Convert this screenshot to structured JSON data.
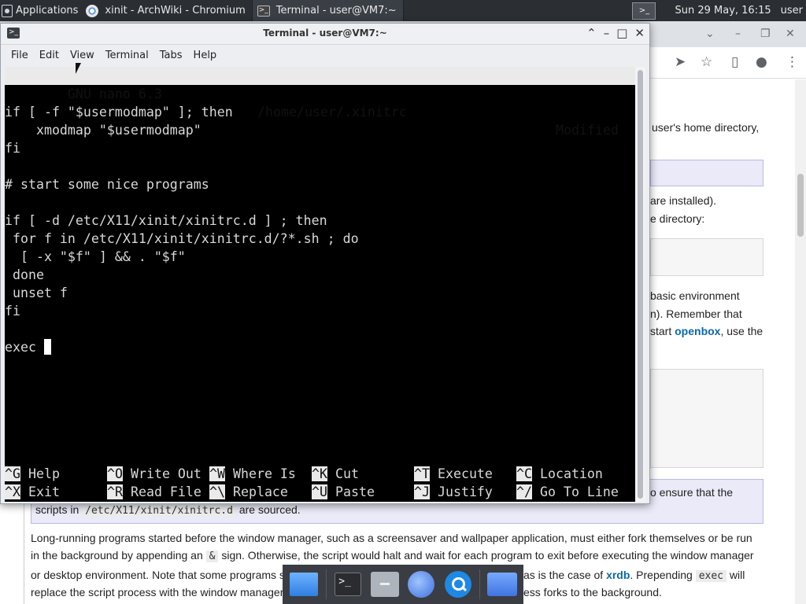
{
  "panel": {
    "applications": "Applications",
    "tasks": [
      {
        "label": "xinit - ArchWiki - Chromium",
        "icon": "chromium-icon"
      },
      {
        "label": "Terminal - user@VM7:~",
        "icon": "terminal-icon"
      }
    ],
    "clock": "Sun 29 May, 16:15",
    "user": "user"
  },
  "browser": {
    "fragments": {
      "f1": "user's home directory,",
      "f2": "are installed).",
      "f3": "e directory:",
      "f4": "basic environment",
      "f5": "n). Remember that",
      "f6_pre": "start ",
      "f6_link": "openbox",
      "f6_post": ", use the",
      "f7": "o ensure that the"
    },
    "scripts_line": {
      "pre": "scripts in",
      "code": "/etc/X11/xinit/xinitrc.d",
      "post": "are sourced."
    },
    "paragraph": {
      "l1": "Long-running programs started before the window manager, such as a screensaver and wallpaper application, must either fork themselves or be run",
      "l2_pre": "in the background by appending an",
      "l2_code": "&",
      "l2_post": "sign. Otherwise, the script would halt and wait for each program to exit before executing the window manager",
      "l3_pre": "or desktop environment. Note that some programs s",
      "l3_mid": "as is the case of",
      "l3_link": "xrdb",
      "l3_post": ". Prepending",
      "l3_code": "exec",
      "l3_tail": "will",
      "l4_pre": "replace the script process with the window manager",
      "l4_post": "ess forks to the background."
    }
  },
  "terminal": {
    "title": "Terminal - user@VM7:~",
    "menu": [
      "File",
      "Edit",
      "View",
      "Terminal",
      "Tabs",
      "Help"
    ],
    "nano": {
      "header_left": "  GNU nano 6.3",
      "header_file": "/home/user/.xinitrc",
      "header_right": "Modified",
      "lines": [
        "",
        "if [ -f \"$usermodmap\" ]; then",
        "    xmodmap \"$usermodmap\"",
        "fi",
        "",
        "# start some nice programs",
        "",
        "if [ -d /etc/X11/xinit/xinitrc.d ] ; then",
        " for f in /etc/X11/xinit/xinitrc.d/?*.sh ; do",
        "  [ -x \"$f\" ] && . \"$f\"",
        " done",
        " unset f",
        "fi",
        "",
        "exec "
      ],
      "shortcuts_row1": [
        {
          "key": "^G",
          "label": "Help"
        },
        {
          "key": "^O",
          "label": "Write Out"
        },
        {
          "key": "^W",
          "label": "Where Is"
        },
        {
          "key": "^K",
          "label": "Cut"
        },
        {
          "key": "^T",
          "label": "Execute"
        },
        {
          "key": "^C",
          "label": "Location"
        }
      ],
      "shortcuts_row2": [
        {
          "key": "^X",
          "label": "Exit"
        },
        {
          "key": "^R",
          "label": "Read File"
        },
        {
          "key": "^\\",
          "label": "Replace"
        },
        {
          "key": "^U",
          "label": "Paste"
        },
        {
          "key": "^J",
          "label": "Justify"
        },
        {
          "key": "^/",
          "label": "Go To Line"
        }
      ]
    }
  },
  "dock": [
    "show-desktop-icon",
    "terminal-icon",
    "file-manager-icon",
    "web-browser-icon",
    "app-finder-icon",
    "home-folder-icon"
  ]
}
